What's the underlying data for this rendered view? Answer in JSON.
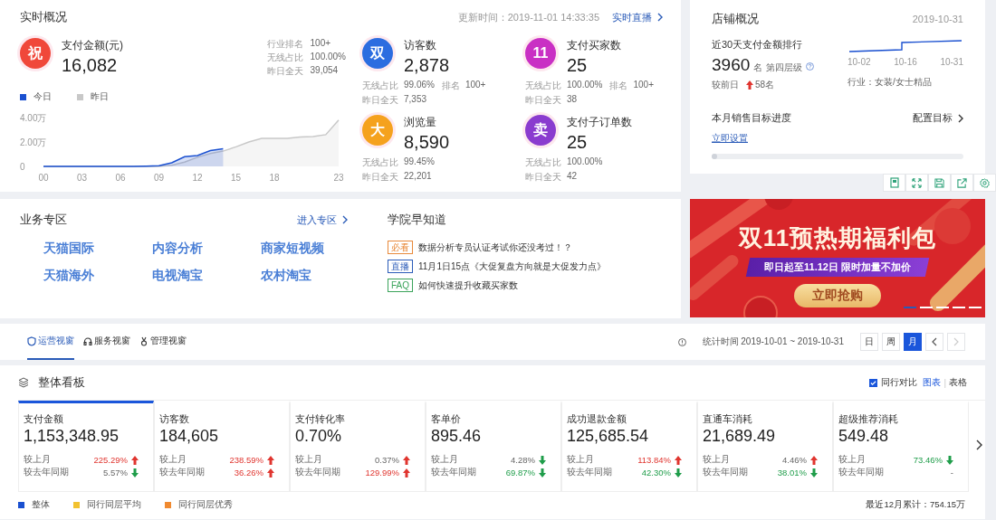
{
  "realtime": {
    "title": "实时概况",
    "update_time": "更新时间：2019-11-01 14:33:35",
    "live_link": "实时直播",
    "main_metric": {
      "badge": "祝",
      "color": "#f0483a",
      "label": "支付金额(元)",
      "value": "16,082",
      "stats": [
        {
          "label": "行业排名",
          "value": "100+"
        },
        {
          "label": "无线占比",
          "value": "100.00%"
        },
        {
          "label": "昨日全天",
          "value": "39,054"
        }
      ]
    },
    "chart_data": {
      "type": "area",
      "x": [
        0,
        1,
        2,
        3,
        4,
        5,
        6,
        7,
        8,
        9,
        10,
        11,
        12,
        13,
        14,
        15,
        16,
        17,
        18,
        19,
        20,
        21,
        22,
        23
      ],
      "xticks": [
        {
          "value": 0,
          "label": "00"
        },
        {
          "value": 3,
          "label": "03"
        },
        {
          "value": 6,
          "label": "06"
        },
        {
          "value": 9,
          "label": "09"
        },
        {
          "value": 12,
          "label": "12"
        },
        {
          "value": 15,
          "label": "15"
        },
        {
          "value": 18,
          "label": "18"
        },
        {
          "value": 23,
          "label": "23"
        }
      ],
      "yticks": [
        {
          "value": 0,
          "label": "0"
        },
        {
          "value": 2,
          "label": "2.00万"
        },
        {
          "value": 4,
          "label": "4.00万"
        }
      ],
      "ylim": [
        0,
        4
      ],
      "xlim": [
        0,
        23
      ],
      "series": [
        {
          "name": "今日",
          "color": "#1a50d0",
          "values": [
            0,
            0,
            0,
            0,
            0,
            0,
            0,
            0,
            0.02,
            0.05,
            0.3,
            0.8,
            0.9,
            1.3,
            1.45,
            null,
            null,
            null,
            null,
            null,
            null,
            null,
            null,
            null
          ]
        },
        {
          "name": "昨日",
          "color": "#c8c8c8",
          "values": [
            0,
            0,
            0,
            0,
            0,
            0,
            0,
            0,
            0,
            0,
            0.1,
            0.35,
            0.75,
            1.05,
            1.25,
            1.6,
            2.0,
            2.3,
            2.3,
            2.3,
            2.4,
            2.45,
            2.6,
            3.8
          ]
        }
      ]
    },
    "metrics": [
      {
        "badge": "双",
        "color": "#2c6de0",
        "label": "访客数",
        "value": "2,878",
        "rows": [
          [
            {
              "label": "无线占比",
              "value": "99.06%"
            },
            {
              "label": "排名",
              "value": "100+"
            }
          ],
          [
            {
              "label": "昨日全天",
              "value": "7,353"
            }
          ]
        ]
      },
      {
        "badge": "11",
        "color": "#c930c4",
        "label": "支付买家数",
        "value": "25",
        "rows": [
          [
            {
              "label": "无线占比",
              "value": "100.00%"
            },
            {
              "label": "排名",
              "value": "100+"
            }
          ],
          [
            {
              "label": "昨日全天",
              "value": "38"
            }
          ]
        ]
      },
      {
        "badge": "大",
        "color": "#f5a21e",
        "label": "浏览量",
        "value": "8,590",
        "rows": [
          [
            {
              "label": "无线占比",
              "value": "99.45%"
            }
          ],
          [
            {
              "label": "昨日全天",
              "value": "22,201"
            }
          ]
        ]
      },
      {
        "badge": "卖",
        "color": "#8a3ccf",
        "label": "支付子订单数",
        "value": "25",
        "rows": [
          [
            {
              "label": "无线占比",
              "value": "100.00%"
            }
          ],
          [
            {
              "label": "昨日全天",
              "value": "42"
            }
          ]
        ]
      }
    ]
  },
  "shop": {
    "title": "店铺概况",
    "date": "2019-10-31",
    "rank_label": "近30天支付金额排行",
    "rank_value": "3960",
    "rank_unit": "名",
    "tier": "第四层级",
    "compare_label": "较前日",
    "compare_value": "58名",
    "spark_labels": [
      "10-02",
      "10-16",
      "10-31"
    ],
    "industry": "行业：女装/女士精品",
    "goal_title": "本月销售目标进度",
    "goal_link": "配置目标",
    "set_link": "立即设置",
    "goal": {
      "level": 0
    }
  },
  "business": {
    "title": "业务专区",
    "enter_link": "进入专区",
    "links": [
      "天猫国际",
      "内容分析",
      "商家短视频",
      "天猫海外",
      "电视淘宝",
      "农村淘宝"
    ]
  },
  "academy": {
    "title": "学院早知道",
    "items": [
      {
        "tag": "必看",
        "color": "#e8893a",
        "text": "数据分析专员认证考试你还没考过！？"
      },
      {
        "tag": "直播",
        "color": "#2a5bb8",
        "text": "11月1日15点《大促复盘方向就是大促发力点》"
      },
      {
        "tag": "FAQ",
        "color": "#3aa35a",
        "text": "如何快速提升收藏买家数"
      }
    ]
  },
  "banner": {
    "title": "双11预热期福利包",
    "subtitle": "即日起至11.12日 限时加量不加价",
    "button": "立即抢购",
    "slides": [
      {
        "selected": true
      },
      {
        "selected": false
      },
      {
        "selected": false
      },
      {
        "selected": false
      },
      {
        "selected": false
      }
    ]
  },
  "view_tabs": [
    {
      "label": "运营视窗",
      "kind": "shield",
      "selected": true
    },
    {
      "label": "服务视窗",
      "kind": "headset",
      "selected": false
    },
    {
      "label": "管理视窗",
      "kind": "medal",
      "selected": false
    }
  ],
  "stat_period": "统计时间 2019-10-01 ~ 2019-10-31",
  "periods": [
    {
      "label": "日",
      "selected": false
    },
    {
      "label": "周",
      "selected": false
    },
    {
      "label": "月",
      "selected": true
    }
  ],
  "pager": {
    "prev_disabled": false,
    "next_disabled": true
  },
  "board": {
    "title": "整体看板",
    "peer_compare": {
      "label": "同行对比",
      "checked": true
    },
    "views": [
      {
        "label": "图表",
        "selected": true
      },
      {
        "label": "表格",
        "selected": false
      }
    ],
    "separator": "|",
    "cards": [
      {
        "label": "支付金额",
        "value": "1,153,348.95",
        "selected": true,
        "stats": [
          {
            "label": "较上月",
            "value": "225.29%",
            "kind": "up",
            "emphasis": true
          },
          {
            "label": "较去年同期",
            "value": "5.57%",
            "kind": "down",
            "emphasis": false
          }
        ]
      },
      {
        "label": "访客数",
        "value": "184,605",
        "selected": false,
        "stats": [
          {
            "label": "较上月",
            "value": "238.59%",
            "kind": "up",
            "emphasis": true
          },
          {
            "label": "较去年同期",
            "value": "36.26%",
            "kind": "up",
            "emphasis": true
          }
        ]
      },
      {
        "label": "支付转化率",
        "value": "0.70%",
        "selected": false,
        "stats": [
          {
            "label": "较上月",
            "value": "0.37%",
            "kind": "up",
            "emphasis": false
          },
          {
            "label": "较去年同期",
            "value": "129.99%",
            "kind": "up",
            "emphasis": true
          }
        ]
      },
      {
        "label": "客单价",
        "value": "895.46",
        "selected": false,
        "stats": [
          {
            "label": "较上月",
            "value": "4.28%",
            "kind": "down",
            "emphasis": false
          },
          {
            "label": "较去年同期",
            "value": "69.87%",
            "kind": "down",
            "emphasis": true
          }
        ]
      },
      {
        "label": "成功退款金额",
        "value": "125,685.54",
        "selected": false,
        "stats": [
          {
            "label": "较上月",
            "value": "113.84%",
            "kind": "up",
            "emphasis": true
          },
          {
            "label": "较去年同期",
            "value": "42.30%",
            "kind": "down",
            "emphasis": true
          }
        ]
      },
      {
        "label": "直通车消耗",
        "value": "21,689.49",
        "selected": false,
        "stats": [
          {
            "label": "较上月",
            "value": "4.46%",
            "kind": "up",
            "emphasis": false
          },
          {
            "label": "较去年同期",
            "value": "38.01%",
            "kind": "down",
            "emphasis": true
          }
        ]
      },
      {
        "label": "超级推荐消耗",
        "value": "549.48",
        "selected": false,
        "stats": [
          {
            "label": "较上月",
            "value": "73.46%",
            "kind": "down",
            "emphasis": true
          },
          {
            "label": "较去年同期",
            "value": "-",
            "kind": "none",
            "emphasis": false
          }
        ]
      }
    ],
    "legend": [
      {
        "label": "整体",
        "color": "#1a50d0"
      },
      {
        "label": "同行同层平均",
        "color": "#f2c230"
      },
      {
        "label": "同行同层优秀",
        "color": "#f08a30"
      }
    ],
    "total": "最近12月累计：754.15万"
  }
}
